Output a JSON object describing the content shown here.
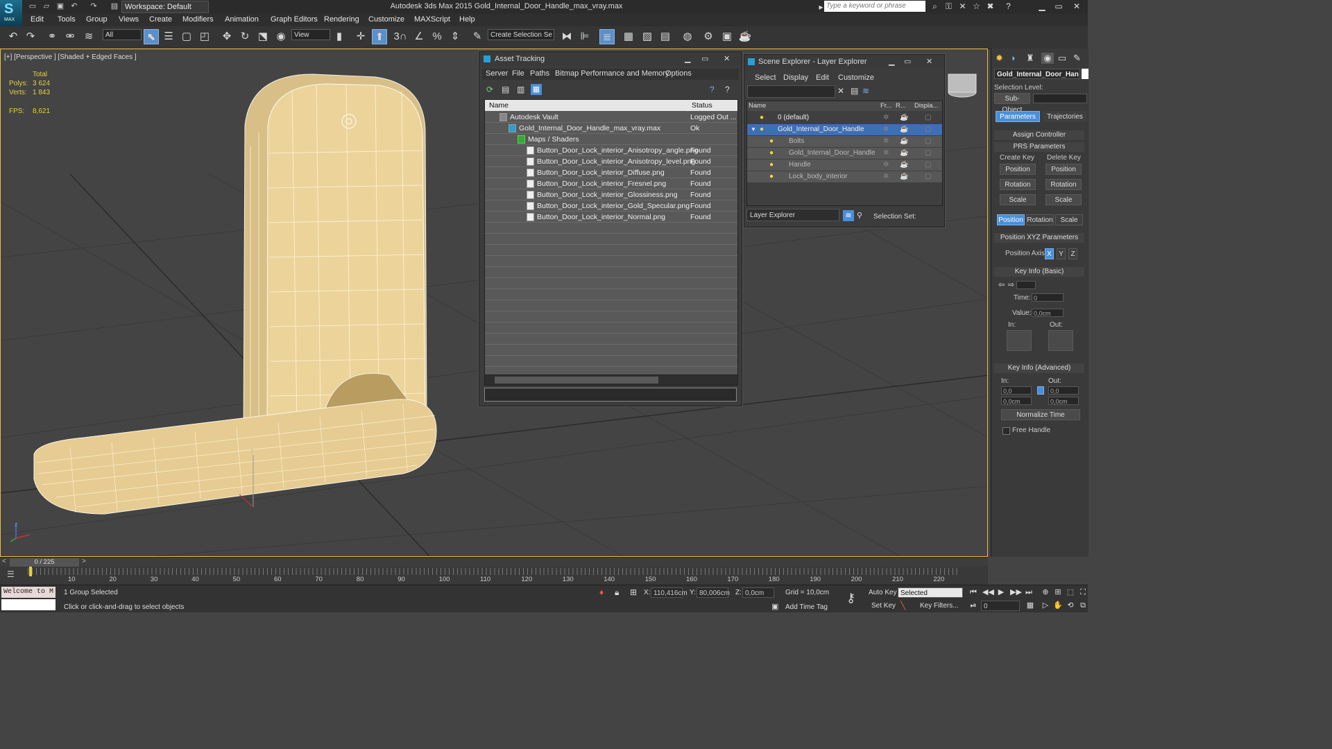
{
  "app": {
    "logo_text": "MAX",
    "title": "Autodesk 3ds Max  2015    Gold_Internal_Door_Handle_max_vray.max",
    "workspace_label": "Workspace: Default",
    "search_placeholder": "Type a keyword or phrase"
  },
  "menu": [
    "Edit",
    "Tools",
    "Group",
    "Views",
    "Create",
    "Modifiers",
    "Animation",
    "Graph Editors",
    "Rendering",
    "Customize",
    "MAXScript",
    "Help"
  ],
  "toolbar": {
    "filter_select": "All",
    "view_select": "View",
    "selection_set": "Create Selection Se",
    "snap_3": "3"
  },
  "viewport": {
    "label": "[+] [Perspective ] [Shaded + Edged Faces ]",
    "stats_total": "Total",
    "polys_label": "Polys:",
    "polys_value": "3 624",
    "verts_label": "Verts:",
    "verts_value": "1 843",
    "fps_label": "FPS:",
    "fps_value": "8,621",
    "gizmo_z": "z",
    "gizmo_y": "y"
  },
  "asset_tracking": {
    "title": "Asset Tracking",
    "menu": [
      "Server",
      "File",
      "Paths",
      "Bitmap Performance and Memory",
      "Options"
    ],
    "col_name": "Name",
    "col_status": "Status",
    "rows": [
      {
        "name": "Autodesk Vault",
        "status": "Logged Out ...",
        "indent": 1,
        "kind": "vault"
      },
      {
        "name": "Gold_Internal_Door_Handle_max_vray.max",
        "status": "Ok",
        "indent": 2,
        "kind": "max"
      },
      {
        "name": "Maps / Shaders",
        "status": "",
        "indent": 3,
        "kind": "folder"
      },
      {
        "name": "Button_Door_Lock_interior_Anisotropy_angle.png",
        "status": "Found",
        "indent": 4,
        "kind": "file"
      },
      {
        "name": "Button_Door_Lock_interior_Anisotropy_level.png",
        "status": "Found",
        "indent": 4,
        "kind": "file"
      },
      {
        "name": "Button_Door_Lock_interior_Diffuse.png",
        "status": "Found",
        "indent": 4,
        "kind": "file"
      },
      {
        "name": "Button_Door_Lock_interior_Fresnel.png",
        "status": "Found",
        "indent": 4,
        "kind": "file"
      },
      {
        "name": "Button_Door_Lock_interior_Glossiness.png",
        "status": "Found",
        "indent": 4,
        "kind": "file"
      },
      {
        "name": "Button_Door_Lock_interior_Gold_Specular.png",
        "status": "Found",
        "indent": 4,
        "kind": "file"
      },
      {
        "name": "Button_Door_Lock_interior_Normal.png",
        "status": "Found",
        "indent": 4,
        "kind": "file"
      }
    ]
  },
  "scene_explorer": {
    "title": "Scene Explorer - Layer Explorer",
    "menu": [
      "Select",
      "Display",
      "Edit",
      "Customize"
    ],
    "col_name": "Name",
    "col_freeze": "Fr...",
    "col_render": "R...",
    "col_display": "Displa...",
    "rows": [
      {
        "name": "0 (default)",
        "indent": 1,
        "selected": false,
        "dim": false
      },
      {
        "name": "Gold_Internal_Door_Handle",
        "indent": 1,
        "selected": true,
        "dim": false
      },
      {
        "name": "Bolts",
        "indent": 2,
        "selected": false,
        "dim": true
      },
      {
        "name": "Gold_Internal_Door_Handle",
        "indent": 2,
        "selected": false,
        "dim": true
      },
      {
        "name": "Handle",
        "indent": 2,
        "selected": false,
        "dim": true
      },
      {
        "name": "Lock_body_interior",
        "indent": 2,
        "selected": false,
        "dim": true
      }
    ],
    "footer_select": "Layer Explorer",
    "selection_set_label": "Selection Set:"
  },
  "command_panel": {
    "object_name": "Gold_Internal_Door_Han",
    "selection_level": "Selection Level:",
    "sub_object": "Sub-Object",
    "tab_parameters": "Parameters",
    "tab_trajectories": "Trajectories",
    "assign_controller": "Assign Controller",
    "prs_parameters": "PRS Parameters",
    "create_key": "Create Key",
    "delete_key": "Delete Key",
    "position": "Position",
    "rotation": "Rotation",
    "scale": "Scale",
    "pos_xyz": "Position XYZ Parameters",
    "position_axis": "Position Axis:",
    "axis_x": "X",
    "axis_y": "Y",
    "axis_z": "Z",
    "key_info_basic": "Key Info (Basic)",
    "time_label": "Time:",
    "time_value": "0",
    "value_label": "Value:",
    "value_value": "0,0cm",
    "in_label": "In:",
    "out_label": "Out:",
    "key_info_adv": "Key Info (Advanced)",
    "adv_in_1": "0,0",
    "adv_out_1": "0,0",
    "adv_in_2": "0,0cm",
    "adv_out_2": "0,0cm",
    "normalize_time": "Normalize Time",
    "free_handle": "Free Handle"
  },
  "timeline": {
    "frame_display": "0 / 225",
    "ticks": [
      "10",
      "20",
      "30",
      "40",
      "50",
      "60",
      "70",
      "80",
      "90",
      "100",
      "110",
      "120",
      "130",
      "140",
      "150",
      "160",
      "170",
      "180",
      "190",
      "200",
      "210",
      "220"
    ]
  },
  "status": {
    "welcome": "Welcome to M",
    "selected_text": "1 Group Selected",
    "prompt": "Click or click-and-drag to select objects",
    "x_label": "X:",
    "x_value": "110,416cm",
    "y_label": "Y:",
    "y_value": "80,006cm",
    "z_label": "Z:",
    "z_value": "0,0cm",
    "grid": "Grid = 10,0cm",
    "add_time_tag": "Add Time Tag",
    "auto_key": "Auto Key",
    "auto_key_select": "Selected",
    "set_key": "Set Key",
    "key_filters": "Key Filters...",
    "frame_value": "0"
  }
}
